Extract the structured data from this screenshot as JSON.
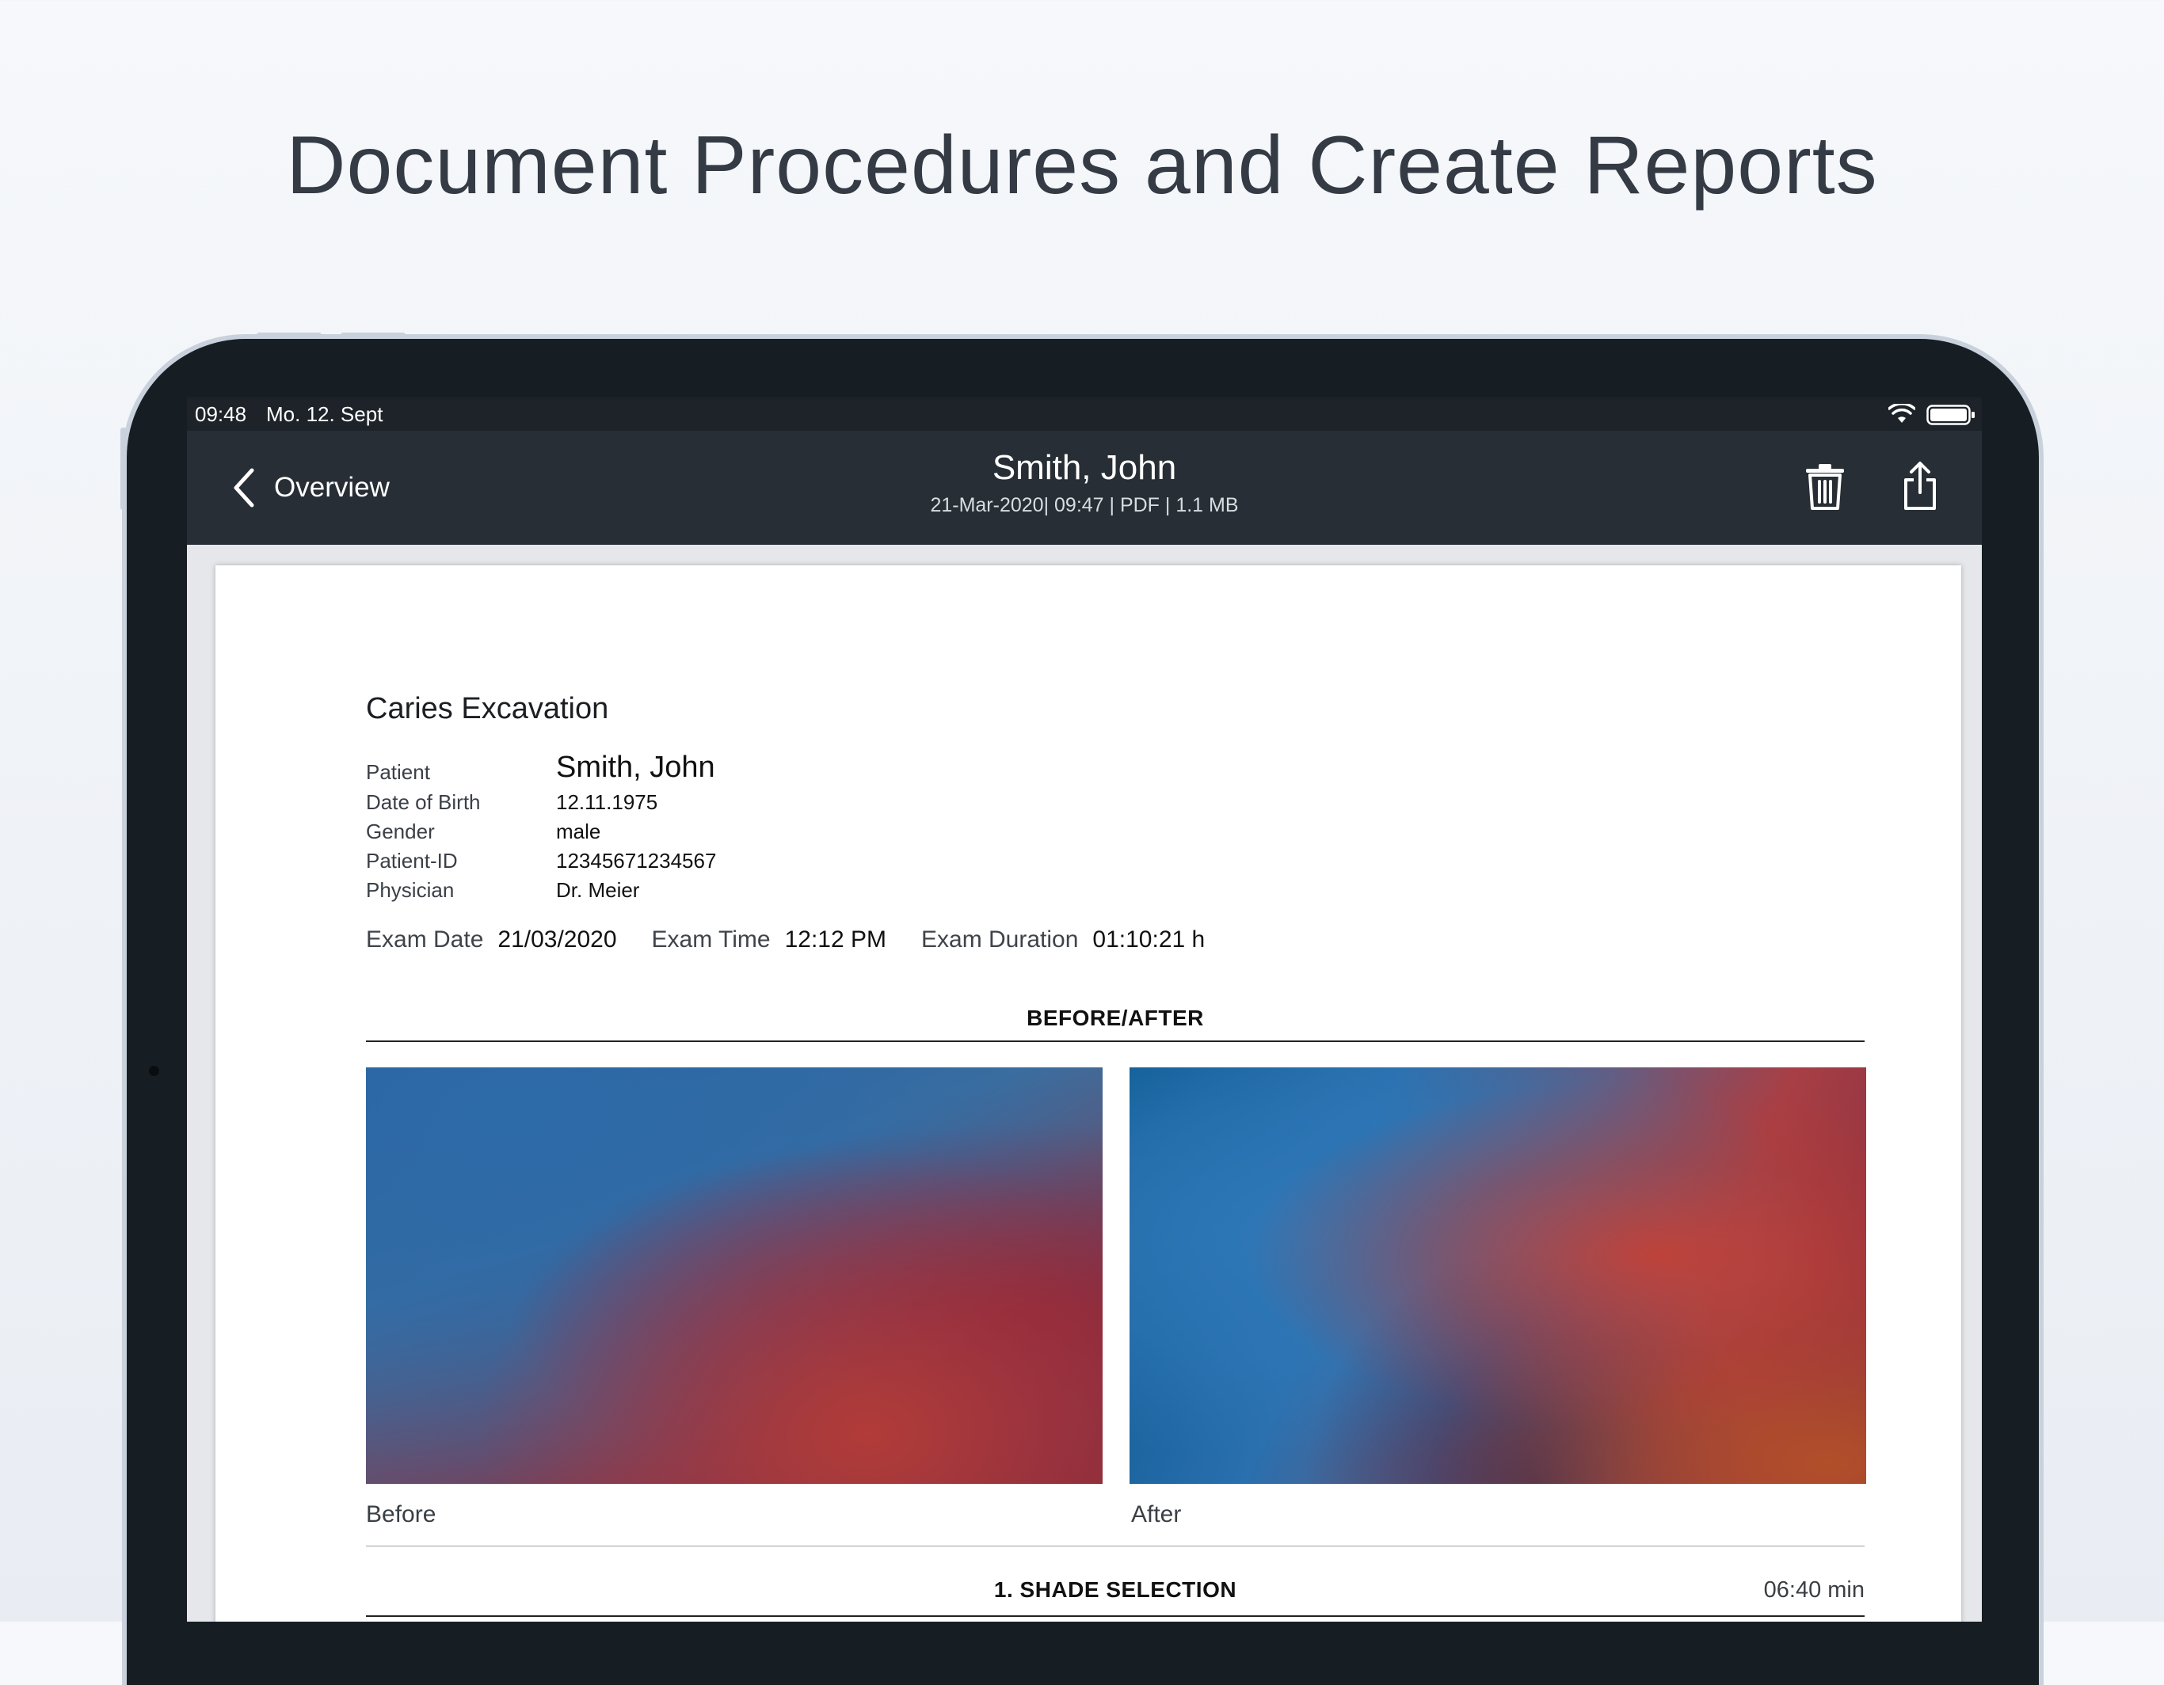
{
  "headline": "Document Procedures and Create Reports",
  "status_bar": {
    "time": "09:48",
    "date": "Mo. 12. Sept",
    "wifi_icon": "wifi-icon",
    "battery_icon": "battery-icon"
  },
  "nav": {
    "back_label": "Overview",
    "title": "Smith, John",
    "subtitle": "21-Mar-2020| 09:47 | PDF | 1.1 MB",
    "actions": [
      "trash-icon",
      "share-icon"
    ]
  },
  "report": {
    "title": "Caries Excavation",
    "patient_info": [
      {
        "label": "Patient",
        "value": "Smith, John"
      },
      {
        "label": "Date of Birth",
        "value": "12.11.1975"
      },
      {
        "label": "Gender",
        "value": "male"
      },
      {
        "label": "Patient-ID",
        "value": "12345671234567"
      },
      {
        "label": "Physician",
        "value": "Dr. Meier"
      }
    ],
    "exam": {
      "date_label": "Exam Date",
      "date_value": "21/03/2020",
      "time_label": "Exam Time",
      "time_value": "12:12 PM",
      "duration_label": "Exam Duration",
      "duration_value": "01:10:21 h"
    },
    "before_after": {
      "heading": "BEFORE/AFTER",
      "before_caption": "Before",
      "after_caption": "After"
    },
    "step1": {
      "heading": "1. SHADE SELECTION",
      "duration": "06:40 min"
    }
  },
  "colors": {
    "background": "#eef1f5",
    "device_frame": "#161d23",
    "navbar": "#272e35",
    "headline_text": "#343b45"
  }
}
